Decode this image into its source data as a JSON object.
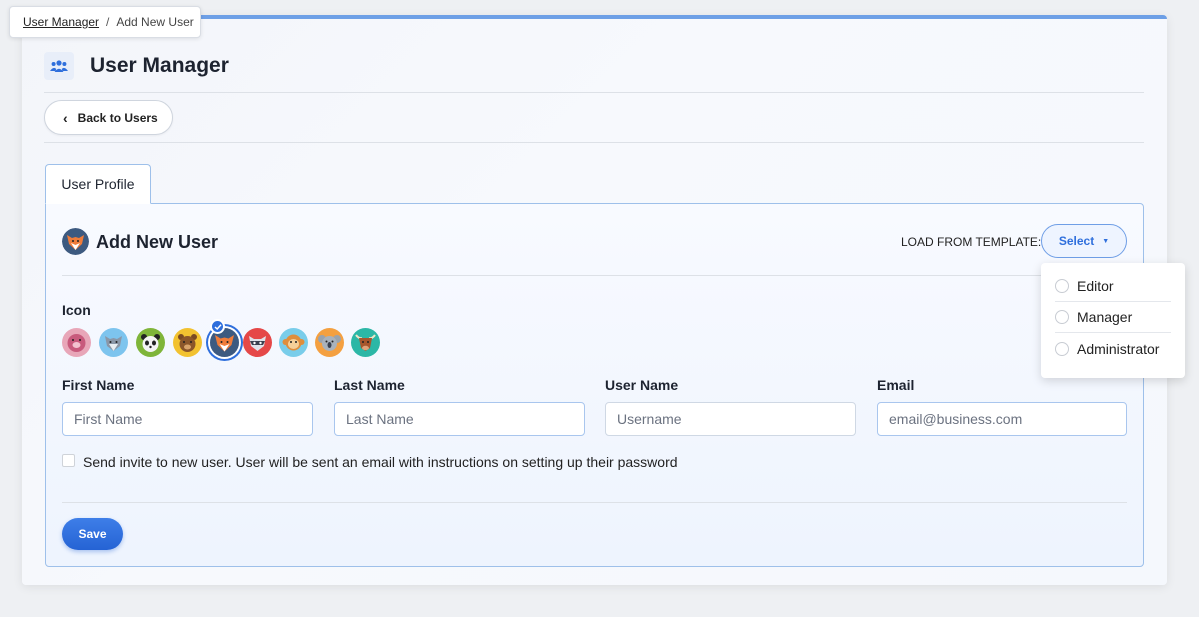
{
  "breadcrumb": {
    "parent": "User Manager",
    "separator": "/",
    "current": "Add New User"
  },
  "header": {
    "title": "User Manager",
    "icon": "users-icon"
  },
  "back_button": {
    "label": "Back to Users"
  },
  "tabs": [
    {
      "label": "User Profile",
      "active": true
    }
  ],
  "form": {
    "title": "Add New User",
    "selected_icon": "fox",
    "template": {
      "label": "LOAD FROM TEMPLATE:",
      "button_label": "Select",
      "options": [
        {
          "label": "Editor"
        },
        {
          "label": "Manager"
        },
        {
          "label": "Administrator"
        }
      ]
    },
    "icon_label": "Icon",
    "icons": [
      "pig-icon",
      "wolf-icon",
      "panda-icon",
      "bear-icon",
      "fox-icon",
      "raccoon-icon",
      "monkey-icon",
      "koala-icon",
      "bull-icon"
    ],
    "fields": [
      {
        "label": "First Name",
        "placeholder": "First Name"
      },
      {
        "label": "Last Name",
        "placeholder": "Last Name"
      },
      {
        "label": "User Name",
        "placeholder": "Username"
      },
      {
        "label": "Email",
        "placeholder": "email@business.com"
      }
    ],
    "invite_text": "Send invite to new user. User will be sent an email with instructions on setting up their password",
    "save_label": "Save"
  },
  "colors": {
    "accent": "#2f6fdc",
    "border": "#9ec0ea",
    "top_bar": "#6d9fe6"
  }
}
